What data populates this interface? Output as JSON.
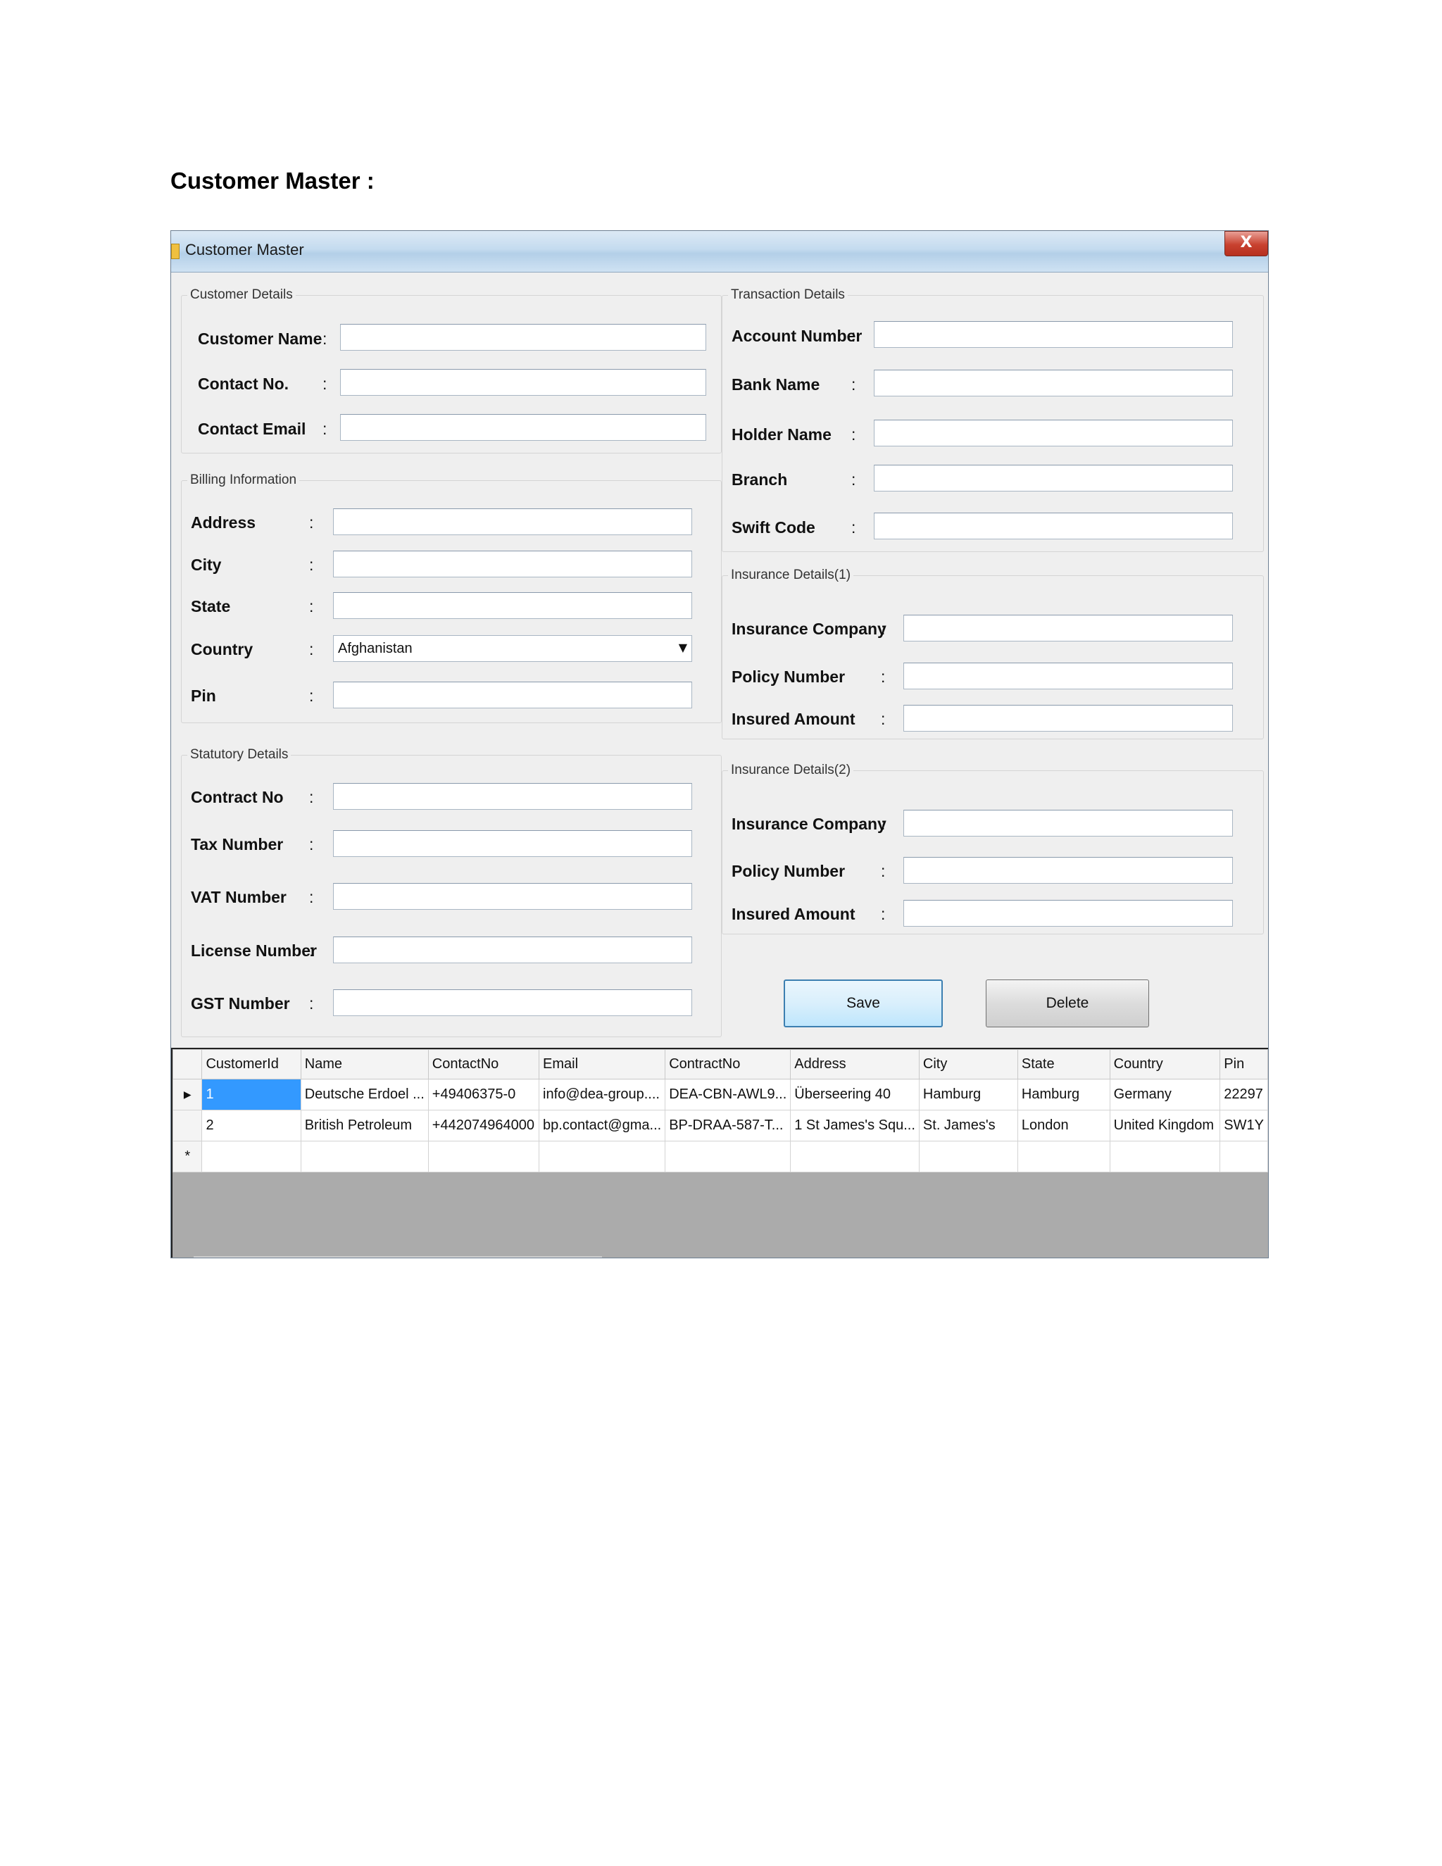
{
  "doc": {
    "heading": "Customer Master :"
  },
  "window": {
    "title": "Customer Master",
    "close_label": "X"
  },
  "customer_details": {
    "legend": "Customer Details",
    "fields": [
      {
        "label": "Customer Name",
        "value": ""
      },
      {
        "label": "Contact No.",
        "value": ""
      },
      {
        "label": "Contact Email",
        "value": ""
      }
    ]
  },
  "billing": {
    "legend": "Billing Information",
    "address_label": "Address",
    "city_label": "City",
    "state_label": "State",
    "country_label": "Country",
    "country_value": "Afghanistan",
    "pin_label": "Pin"
  },
  "statutory": {
    "legend": "Statutory Details",
    "fields": [
      {
        "label": "Contract No",
        "value": ""
      },
      {
        "label": "Tax Number",
        "value": ""
      },
      {
        "label": "VAT Number",
        "value": ""
      },
      {
        "label": "License Number",
        "value": ""
      },
      {
        "label": "GST Number",
        "value": ""
      }
    ]
  },
  "transaction": {
    "legend": "Transaction Details",
    "fields": [
      {
        "label": "Account Number",
        "value": ""
      },
      {
        "label": "Bank Name",
        "value": ""
      },
      {
        "label": "Holder Name",
        "value": ""
      },
      {
        "label": "Branch",
        "value": ""
      },
      {
        "label": "Swift Code",
        "value": ""
      }
    ]
  },
  "insurance1": {
    "legend": "Insurance Details(1)",
    "fields": [
      {
        "label": "Insurance Company",
        "value": ""
      },
      {
        "label": "Policy Number",
        "value": ""
      },
      {
        "label": "Insured Amount",
        "value": ""
      }
    ]
  },
  "insurance2": {
    "legend": "Insurance Details(2)",
    "fields": [
      {
        "label": "Insurance Company",
        "value": ""
      },
      {
        "label": "Policy Number",
        "value": ""
      },
      {
        "label": "Insured Amount",
        "value": ""
      }
    ]
  },
  "buttons": {
    "save": "Save",
    "delete": "Delete"
  },
  "grid": {
    "columns": [
      "CustomerId",
      "Name",
      "ContactNo",
      "Email",
      "ContractNo",
      "Address",
      "City",
      "State",
      "Country",
      "Pin"
    ],
    "rows": [
      [
        "1",
        "Deutsche Erdoel ...",
        "+49406375-0",
        "info@dea-group....",
        "DEA-CBN-AWL9...",
        "Überseering 40",
        "Hamburg",
        "Hamburg",
        "Germany",
        "22297"
      ],
      [
        "2",
        "British Petroleum",
        "+442074964000",
        "bp.contact@gma...",
        "BP-DRAA-587-T...",
        "1 St James's Squ...",
        "St. James's",
        "London",
        "United Kingdom",
        "SW1Y"
      ]
    ],
    "current_row_marker": "▶",
    "new_row_marker": "*"
  }
}
